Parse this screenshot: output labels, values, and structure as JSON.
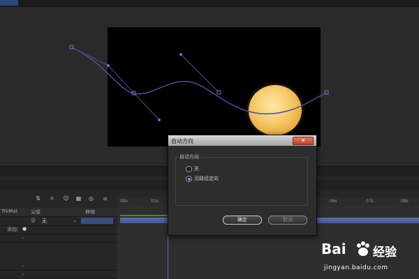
{
  "app": {
    "top_tab": ""
  },
  "composition": {
    "moon": "moon-image"
  },
  "viewer_bar": {
    "zoom": ""
  },
  "timeline": {
    "tab": "",
    "columns": {
      "trkmat": "TrkMat",
      "parent": "父级",
      "stretch": "伸缩"
    },
    "rows": [
      {
        "parent_value": "无",
        "stretch_value": ""
      },
      {
        "label": "添加:"
      }
    ],
    "ruler": [
      "00s",
      "01s",
      "06s",
      "07s",
      "08s"
    ]
  },
  "dialog": {
    "title": "自动方向",
    "close_label": "✕",
    "group_label": "自动方向",
    "options": [
      {
        "label": "关",
        "selected": false
      },
      {
        "label": "沿路径定向",
        "selected": true
      }
    ],
    "ok_label": "确定",
    "cancel_label": "取消"
  },
  "watermark": {
    "brand": "Bai",
    "brand2": "经验",
    "url": "jingyan.baidu.com"
  },
  "colors": {
    "dialog_bg": "#2d2d2d",
    "radio_selected": "#5a9ae0",
    "path": "#4c4f9a",
    "moon": "#f5c867"
  }
}
